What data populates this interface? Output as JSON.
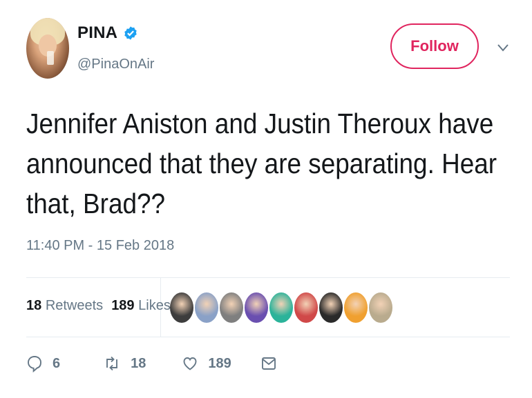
{
  "author": {
    "name": "PINA",
    "handle": "@PinaOnAir",
    "verified": true
  },
  "follow_button": {
    "label": "Follow"
  },
  "tweet": {
    "text": "Jennifer Aniston and Justin Theroux have announced that they are separating. Hear that, Brad??",
    "timestamp": "11:40 PM - 15 Feb 2018"
  },
  "stats": {
    "retweets_count": "18",
    "retweets_label": "Retweets",
    "likes_count": "189",
    "likes_label": "Likes"
  },
  "actions": {
    "reply_count": "6",
    "retweet_count": "18",
    "like_count": "189"
  },
  "likers": [
    {
      "icon": "liker-avatar",
      "color": "#3d3d3d"
    },
    {
      "icon": "liker-avatar",
      "color": "#8aa1c7"
    },
    {
      "icon": "liker-avatar",
      "color": "#7f7f7f"
    },
    {
      "icon": "liker-avatar",
      "color": "#6a4fb0"
    },
    {
      "icon": "liker-avatar",
      "color": "#2bb39a"
    },
    {
      "icon": "liker-avatar",
      "color": "#d04848"
    },
    {
      "icon": "liker-avatar",
      "color": "#2a2a2a"
    },
    {
      "icon": "liker-avatar",
      "color": "#f0a030"
    },
    {
      "icon": "liker-avatar",
      "color": "#b9ab8e"
    }
  ],
  "colors": {
    "accent": "#e0245e",
    "verified": "#1da1f2",
    "secondary_text": "#657786"
  }
}
